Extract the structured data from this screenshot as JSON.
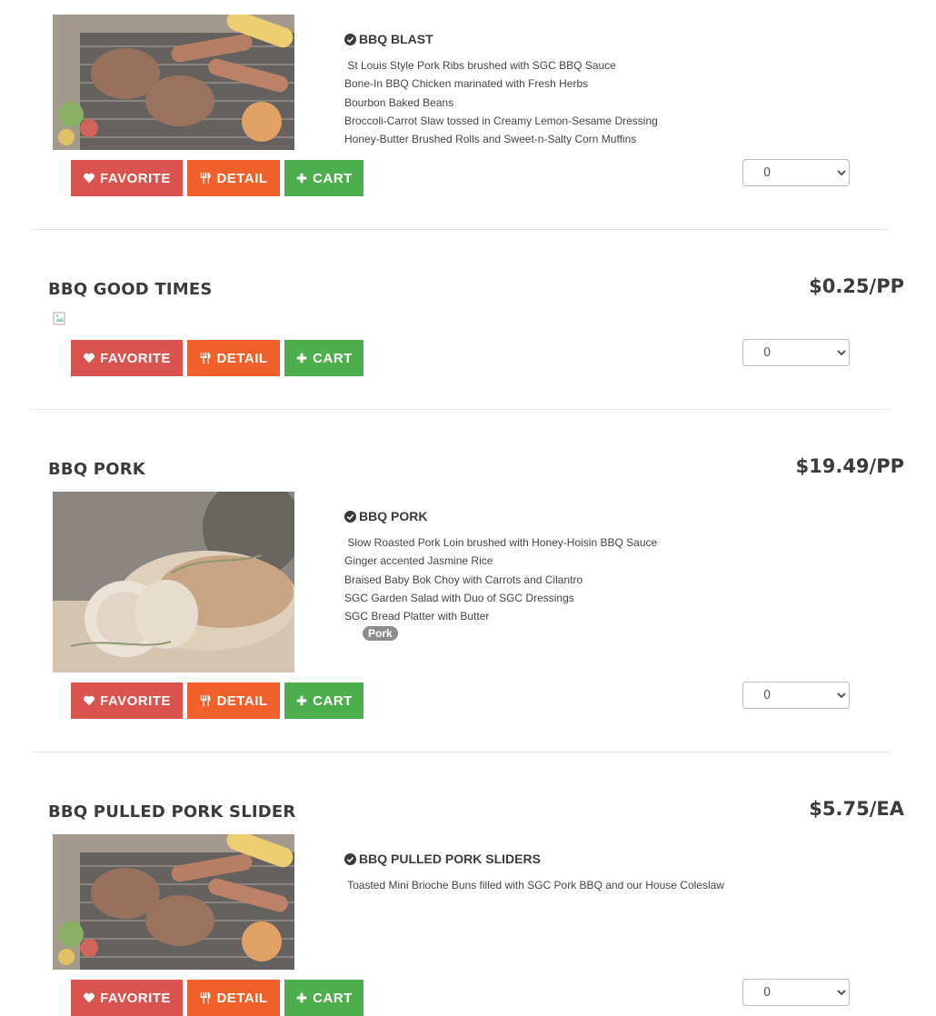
{
  "buttons": {
    "favorite": "FAVORITE",
    "detail": "DETAIL",
    "cart": "CART"
  },
  "items": [
    {
      "title": "",
      "price": "",
      "desc_title": "BBQ BLAST",
      "lines": [
        " St Louis Style Pork Ribs brushed with SGC BBQ Sauce",
        "Bone-In BBQ Chicken marinated with Fresh Herbs",
        "Bourbon Baked Beans",
        "Broccoli-Carrot Slaw tossed in Creamy Lemon-Sesame Dressing",
        "Honey-Butter Brushed Rolls and Sweet-n-Salty Corn Muffins"
      ],
      "qty": "0",
      "image": "grill-platter"
    },
    {
      "title": "BBQ GOOD TIMES",
      "price": "$0.25/PP",
      "qty": "0",
      "image": "broken"
    },
    {
      "title": "BBQ PORK",
      "price": "$19.49/PP",
      "desc_title": "BBQ PORK",
      "lines": [
        " Slow Roasted Pork Loin brushed with Honey-Hoisin BBQ Sauce",
        "Ginger accented Jasmine Rice",
        "Braised Baby Bok Choy with Carrots and Cilantro",
        "SGC Garden Salad with Duo of SGC Dressings",
        "SGC Bread Platter with Butter"
      ],
      "tag": "Pork",
      "qty": "0",
      "image": "pork-loin"
    },
    {
      "title": "BBQ PULLED PORK SLIDER",
      "price": "$5.75/EA",
      "desc_title": "BBQ PULLED PORK SLIDERS",
      "lines": [
        " Toasted Mini Brioche Buns filled with SGC Pork BBQ and our House Coleslaw"
      ],
      "qty": "0",
      "image": "grill-platter"
    }
  ],
  "colors": {
    "favorite": "#d9534f",
    "detail": "#f0602b",
    "cart": "#4cae4c"
  },
  "icons": [
    "check-circle-icon",
    "heart-icon",
    "utensils-icon",
    "plus-icon",
    "chevron-down-icon"
  ]
}
